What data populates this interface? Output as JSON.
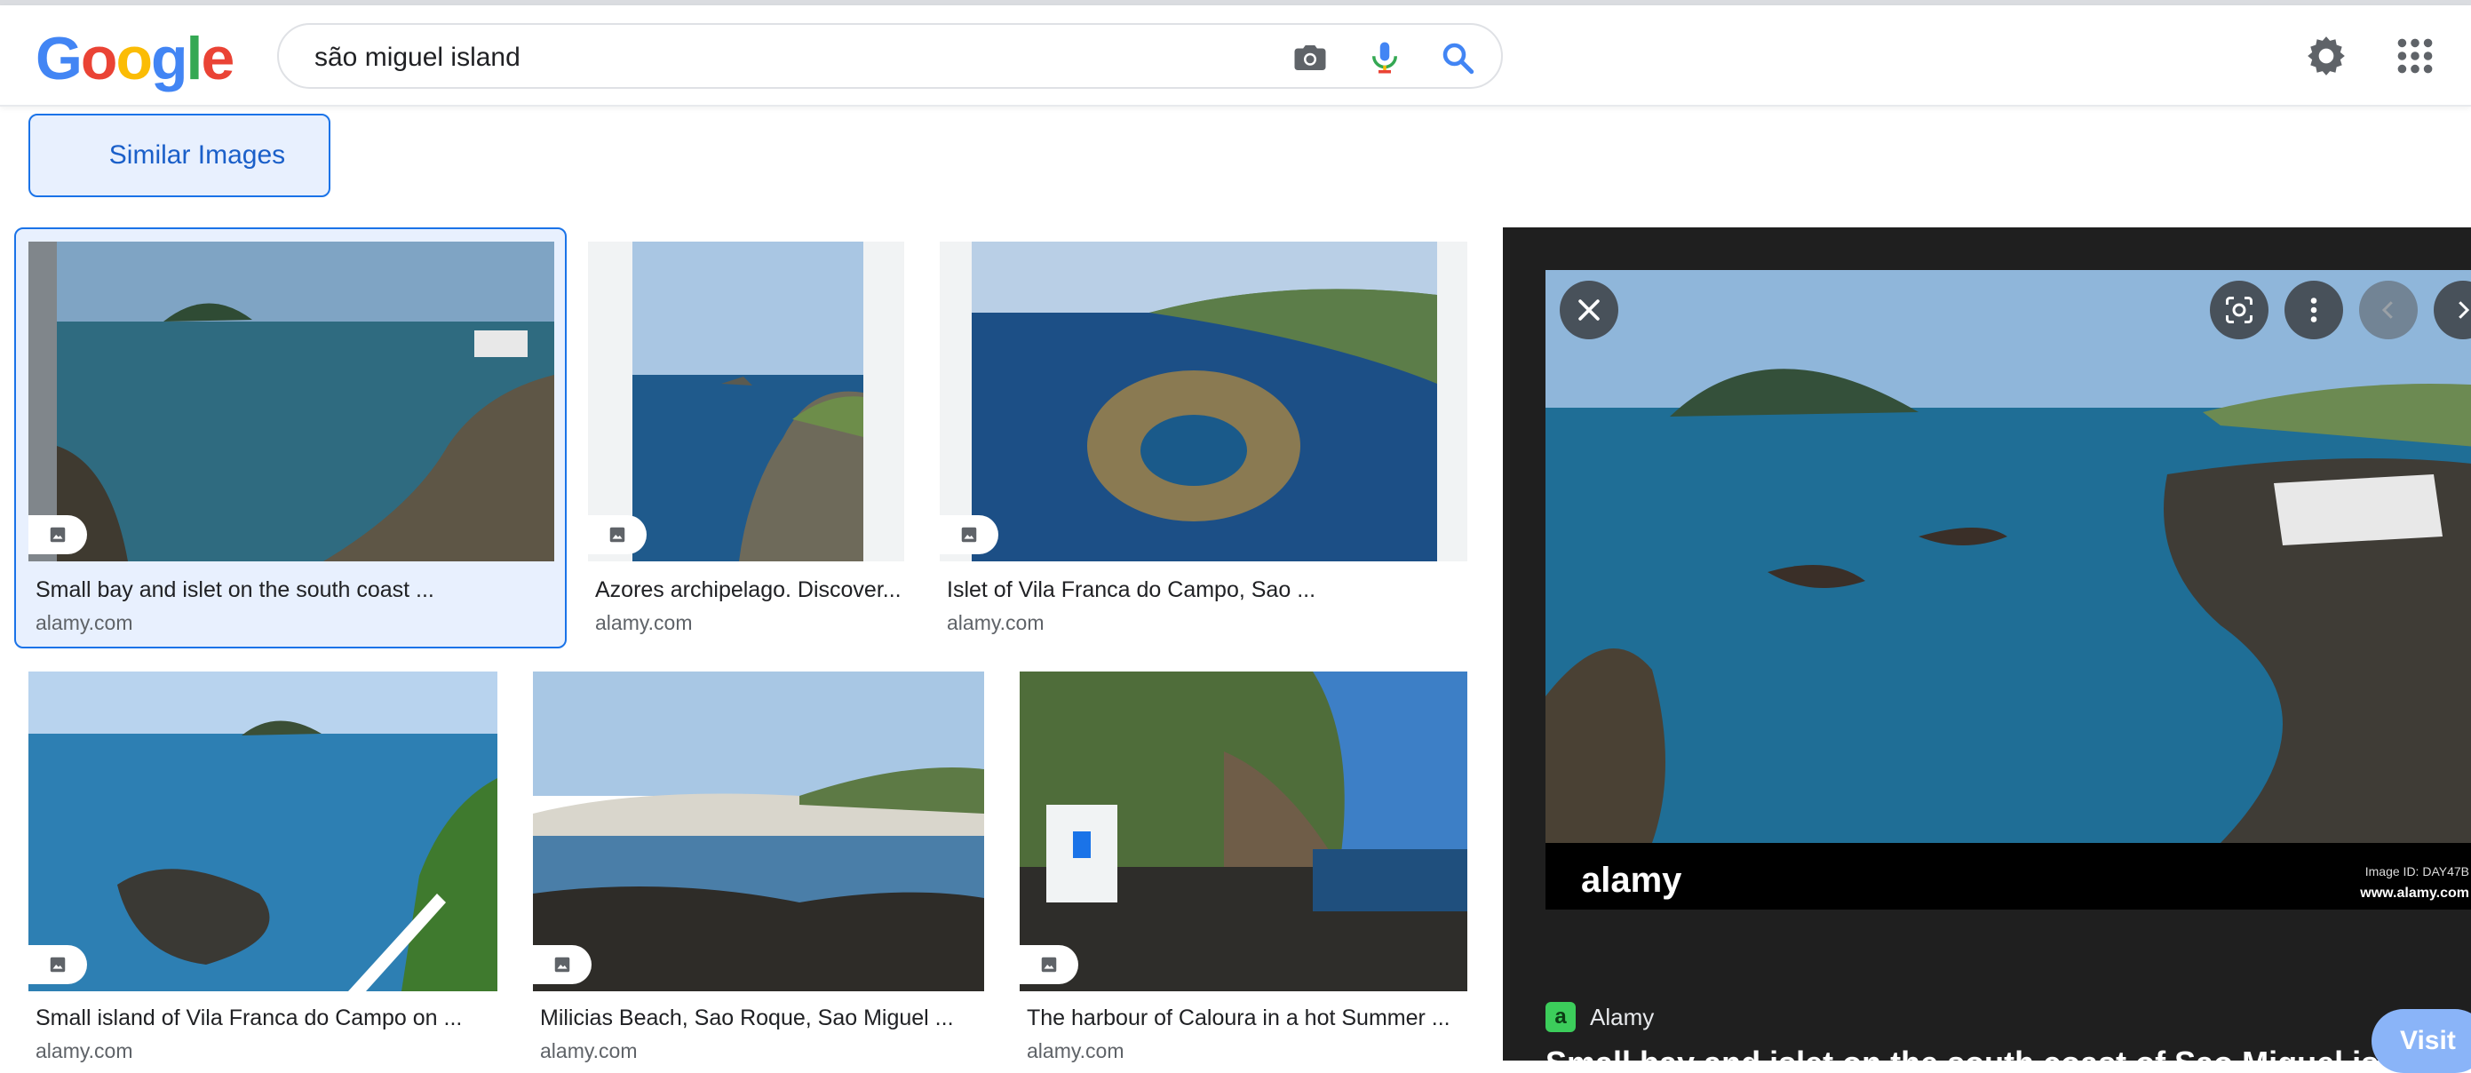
{
  "logo": {
    "letters": [
      "G",
      "o",
      "o",
      "g",
      "l",
      "e"
    ],
    "colors": [
      "#4285F4",
      "#EA4335",
      "#FBBC05",
      "#4285F4",
      "#34A853",
      "#EA4335"
    ]
  },
  "search": {
    "query": "são miguel island",
    "icons": [
      "camera-icon",
      "mic-icon",
      "search-icon"
    ]
  },
  "header_icons": [
    "gear-icon",
    "apps-grid-icon"
  ],
  "similar_images_label": "Similar Images",
  "results": [
    {
      "caption": "Small bay and islet on the south coast ...",
      "source": "alamy.com"
    },
    {
      "caption": "Azores archipelago. Discover...",
      "source": "alamy.com"
    },
    {
      "caption": "Islet of Vila Franca do Campo, Sao ...",
      "source": "alamy.com"
    },
    {
      "caption": "Small island of Vila Franca do Campo on ...",
      "source": "alamy.com"
    },
    {
      "caption": "Milicias Beach, Sao Roque, Sao Miguel ...",
      "source": "alamy.com"
    },
    {
      "caption": "The harbour of Caloura in a hot Summer ...",
      "source": "alamy.com"
    }
  ],
  "preview": {
    "watermark": "alamy",
    "image_id": "Image ID: DAY47B",
    "url_text": "www.alamy.com",
    "site_name": "Alamy",
    "favicon_letter": "a",
    "title": "Small bay and islet on the south coast of Sao Miguel island, Azores",
    "visit_label": "Visit"
  },
  "colors": {
    "accent": "#1a73e8",
    "selected_bg": "#e8f0fe",
    "preview_bg": "#1f1f1f"
  }
}
